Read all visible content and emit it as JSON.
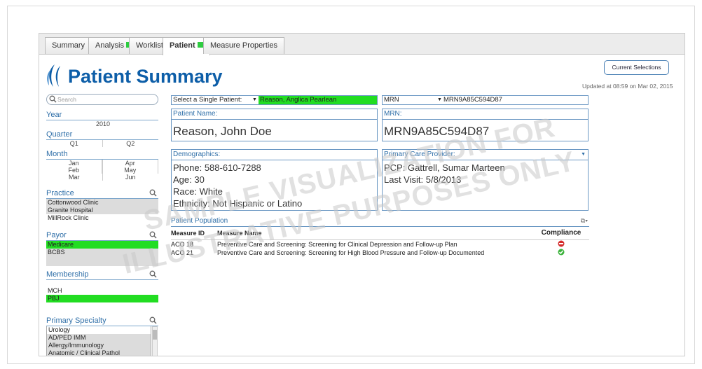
{
  "tabs": [
    {
      "label": "Summary",
      "badge": false
    },
    {
      "label": "Analysis",
      "badge": true
    },
    {
      "label": "Worklist",
      "badge": false
    },
    {
      "label": "Patient",
      "badge": true
    },
    {
      "label": "Measure Properties",
      "badge": false
    }
  ],
  "page_title": "Patient Summary",
  "current_selections_label": "Current Selections",
  "updated_text": "Updated at 08:59 on Mar 02, 2015",
  "search_placeholder": "Search",
  "filters": {
    "year": {
      "label": "Year",
      "value": "2010"
    },
    "quarter": {
      "label": "Quarter",
      "values": [
        "Q1",
        "Q2"
      ]
    },
    "month": {
      "label": "Month",
      "col1": [
        "Jan",
        "Feb",
        "Mar"
      ],
      "col2": [
        "Apr",
        "May",
        "Jun"
      ]
    },
    "practice": {
      "label": "Practice",
      "items": [
        "Cottonwood Clinic",
        "Granite Hospital",
        "MillRock Clinic"
      ]
    },
    "payor": {
      "label": "Payor",
      "items": [
        "Medicare",
        "BCBS"
      ]
    },
    "membership": {
      "label": "Membership",
      "items": [
        "MCH",
        "PBJ"
      ]
    },
    "specialty": {
      "label": "Primary Specialty",
      "items": [
        "Urology",
        "AD/PED IMM",
        "Allergy/Immunology",
        "Anatomic / Clinical Pathol"
      ]
    }
  },
  "patient_select": {
    "label": "Select a Single Patient:",
    "value": "Reason, Anglica Pearlean"
  },
  "mrn_select": {
    "label": "MRN",
    "value": "MRN9A85C594D87"
  },
  "patient_name": {
    "header": "Patient Name:",
    "value": "Reason, John Doe"
  },
  "mrn": {
    "header": "MRN:",
    "value": "MRN9A85C594D87"
  },
  "demographics": {
    "header": "Demographics:",
    "phone": "Phone: 588-610-7288",
    "age": "Age: 30",
    "race": "Race: White",
    "ethnicity": "Ethnicity: Not Hispanic or Latino"
  },
  "pcp": {
    "header": "Primary Care Provider:",
    "name": "PCP: Gattrell, Sumar Marteen",
    "last_visit": "Last Visit: 5/8/2013"
  },
  "population": {
    "header": "Patient Population",
    "col_measure_id": "Measure ID",
    "col_measure_name": "Measure Name",
    "col_compliance": "Compliance",
    "rows": [
      {
        "id": "ACO 18",
        "name": "Preventive Care and Screening: Screening for Clinical Depression and Follow-up Plan",
        "status": "non-compliant"
      },
      {
        "id": "ACO 21",
        "name": "Preventive Care and Screening: Screening for High Blood Pressure and Follow-up Documented",
        "status": "compliant"
      }
    ]
  },
  "watermark": {
    "line1": "SAMPLE VISUALIZATION FOR",
    "line2": "ILLUSTRATIVE PURPOSES ONLY"
  },
  "colors": {
    "accent": "#0d5ea8",
    "selected": "#22dd22",
    "noncompliant": "#d42a2a",
    "compliant": "#3bb23b"
  }
}
